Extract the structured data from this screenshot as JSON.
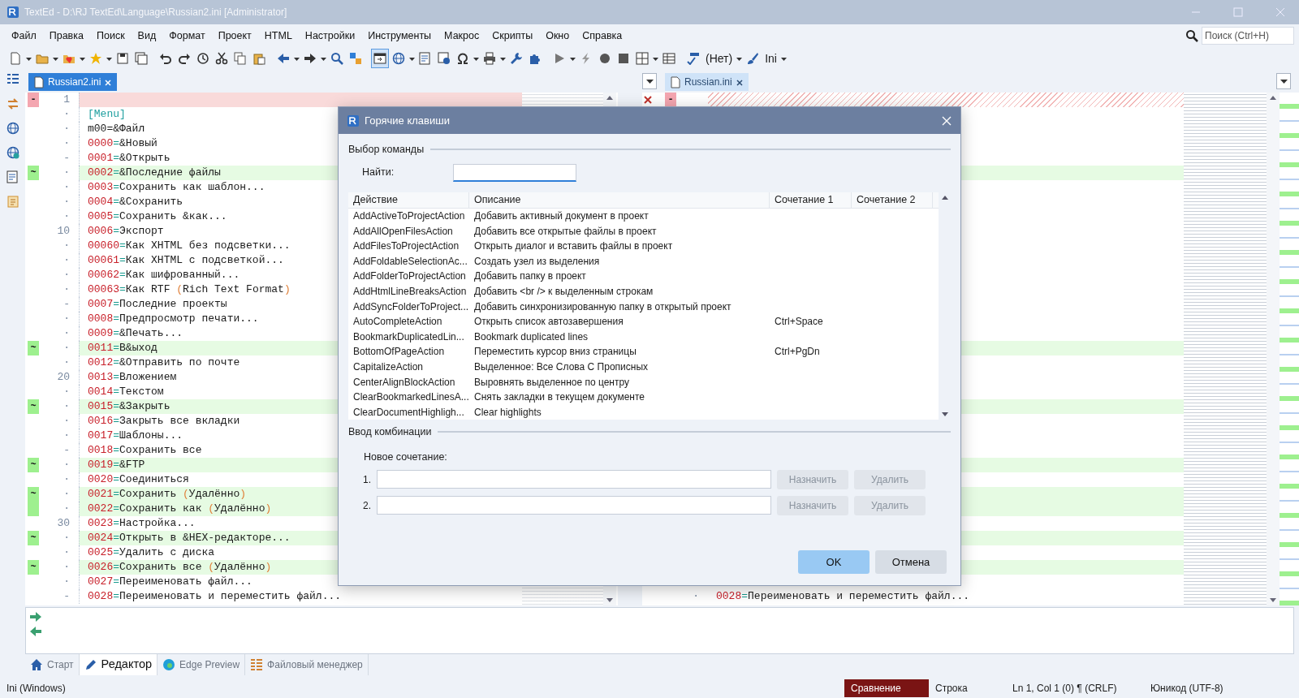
{
  "window": {
    "title": "TextEd - D:\\RJ TextEd\\Language\\Russian2.ini [Administrator]"
  },
  "menu": [
    {
      "label": "Файл"
    },
    {
      "label": "Правка"
    },
    {
      "label": "Поиск"
    },
    {
      "label": "Вид"
    },
    {
      "label": "Формат"
    },
    {
      "label": "Проект"
    },
    {
      "label": "HTML"
    },
    {
      "label": "Настройки"
    },
    {
      "label": "Инструменты"
    },
    {
      "label": "Макрос"
    },
    {
      "label": "Скрипты"
    },
    {
      "label": "Окно"
    },
    {
      "label": "Справка"
    }
  ],
  "search": {
    "placeholder": "Поиск (Ctrl+H)"
  },
  "toolbar": {
    "spell_mode": "(Нет)",
    "syntax": "Ini"
  },
  "tabs_left": [
    {
      "label": "Russian2.ini",
      "selected": true
    }
  ],
  "tabs_right": [
    {
      "label": "Russian.ini",
      "selected": false
    }
  ],
  "editor": {
    "lines": [
      {
        "gutter": "1",
        "deleted": true,
        "changed": false,
        "mark": "-",
        "kind": "empty"
      },
      {
        "gutter": "·",
        "deleted": false,
        "changed": false,
        "kind": "section",
        "text": "[Menu]"
      },
      {
        "gutter": "·",
        "deleted": false,
        "changed": false,
        "kind": "plain",
        "text": "m00=&Файл"
      },
      {
        "gutter": "·",
        "deleted": false,
        "changed": false,
        "kind": "entry",
        "text": "0000=&Новый"
      },
      {
        "gutter": "-",
        "deleted": false,
        "changed": false,
        "kind": "entry",
        "text": "0001=&Открыть"
      },
      {
        "gutter": "·",
        "deleted": false,
        "changed": true,
        "mark": "~",
        "kind": "entry",
        "text": "0002=&Последние файлы"
      },
      {
        "gutter": "·",
        "deleted": false,
        "changed": false,
        "kind": "entry",
        "text": "0003=Сохранить как шаблон..."
      },
      {
        "gutter": "·",
        "deleted": false,
        "changed": false,
        "kind": "entry",
        "text": "0004=&Сохранить"
      },
      {
        "gutter": "·",
        "deleted": false,
        "changed": false,
        "kind": "entry",
        "text": "0005=Сохранить &как..."
      },
      {
        "gutter": "10",
        "deleted": false,
        "changed": false,
        "kind": "entry",
        "text": "0006=Экспорт"
      },
      {
        "gutter": "·",
        "deleted": false,
        "changed": false,
        "kind": "entry",
        "text": "00060=Как XHTML без подсветки..."
      },
      {
        "gutter": "·",
        "deleted": false,
        "changed": false,
        "kind": "entry",
        "text": "00061=Как XHTML с подсветкой..."
      },
      {
        "gutter": "·",
        "deleted": false,
        "changed": false,
        "kind": "entry",
        "text": "00062=Как шифрованный..."
      },
      {
        "gutter": "·",
        "deleted": false,
        "changed": false,
        "kind": "entry",
        "text": "00063=Как RTF (Rich Text Format)"
      },
      {
        "gutter": "-",
        "deleted": false,
        "changed": false,
        "kind": "entry",
        "text": "0007=Последние проекты"
      },
      {
        "gutter": "·",
        "deleted": false,
        "changed": false,
        "kind": "entry",
        "text": "0008=Предпросмотр печати..."
      },
      {
        "gutter": "·",
        "deleted": false,
        "changed": false,
        "kind": "entry",
        "text": "0009=&Печать..."
      },
      {
        "gutter": "·",
        "deleted": false,
        "changed": true,
        "mark": "~",
        "kind": "entry",
        "text": "0011=В&ыход"
      },
      {
        "gutter": "·",
        "deleted": false,
        "changed": false,
        "kind": "entry",
        "text": "0012=&Отправить по почте"
      },
      {
        "gutter": "20",
        "deleted": false,
        "changed": false,
        "kind": "entry",
        "text": "0013=Вложением"
      },
      {
        "gutter": "·",
        "deleted": false,
        "changed": false,
        "kind": "entry",
        "text": "0014=Текстом"
      },
      {
        "gutter": "·",
        "deleted": false,
        "changed": true,
        "mark": "~",
        "kind": "entry",
        "text": "0015=&Закрыть"
      },
      {
        "gutter": "·",
        "deleted": false,
        "changed": false,
        "kind": "entry",
        "text": "0016=Закрыть все вкладки"
      },
      {
        "gutter": "·",
        "deleted": false,
        "changed": false,
        "kind": "entry",
        "text": "0017=Шаблоны..."
      },
      {
        "gutter": "-",
        "deleted": false,
        "changed": false,
        "kind": "entry",
        "text": "0018=Сохранить все"
      },
      {
        "gutter": "·",
        "deleted": false,
        "changed": true,
        "mark": "~",
        "kind": "entry",
        "text": "0019=&FTP"
      },
      {
        "gutter": "·",
        "deleted": false,
        "changed": false,
        "kind": "entry",
        "text": "0020=Соединиться"
      },
      {
        "gutter": "·",
        "deleted": false,
        "changed": true,
        "mark": "~",
        "kind": "entry",
        "text": "0021=Сохранить (Удалённо)"
      },
      {
        "gutter": "·",
        "deleted": false,
        "changed": true,
        "kind": "entry",
        "text": "0022=Сохранить как (Удалённо)"
      },
      {
        "gutter": "30",
        "deleted": false,
        "changed": false,
        "kind": "entry",
        "text": "0023=Настройка..."
      },
      {
        "gutter": "·",
        "deleted": false,
        "changed": true,
        "mark": "~",
        "kind": "entry",
        "text": "0024=Открыть в &HEX-редакторе..."
      },
      {
        "gutter": "·",
        "deleted": false,
        "changed": false,
        "kind": "entry",
        "text": "0025=Удалить с диска"
      },
      {
        "gutter": "·",
        "deleted": false,
        "changed": true,
        "mark": "~",
        "kind": "entry",
        "text": "0026=Сохранить все (Удалённо)"
      },
      {
        "gutter": "·",
        "deleted": false,
        "changed": false,
        "kind": "entry",
        "text": "0027=Переименовать файл..."
      },
      {
        "gutter": "-",
        "deleted": false,
        "changed": false,
        "kind": "entry",
        "text": "0028=Переименовать и переместить файл..."
      }
    ]
  },
  "compare_pane": {
    "mark": "-",
    "gutter": "·",
    "last_line": "0028=Переименовать и переместить файл..."
  },
  "dialog": {
    "title": "Горячие клавиши",
    "select_group": "Выбор команды",
    "find_label": "Найти:",
    "find_focused": true,
    "columns": [
      "Действие",
      "Описание",
      "Сочетание 1",
      "Сочетание 2"
    ],
    "rows": [
      {
        "action": "AddActiveToProjectAction",
        "description": "Добавить активный документ в проект"
      },
      {
        "action": "AddAllOpenFilesAction",
        "description": "Добавить все открытые файлы в проект"
      },
      {
        "action": "AddFilesToProjectAction",
        "description": "Открыть диалог и вставить файлы в проект"
      },
      {
        "action": "AddFoldableSelectionAc...",
        "description": "Создать узел из выделения"
      },
      {
        "action": "AddFolderToProjectAction",
        "description": "Добавить папку в проект"
      },
      {
        "action": "AddHtmlLineBreaksAction",
        "description": "Добавить <br /> к выделенным строкам"
      },
      {
        "action": "AddSyncFolderToProject...",
        "description": "Добавить синхронизированную папку в открытый проект"
      },
      {
        "action": "AutoCompleteAction",
        "description": "Открыть список автозавершения",
        "shortcut_1": "Ctrl+Space"
      },
      {
        "action": "BookmarkDuplicatedLin...",
        "description": "Bookmark duplicated lines"
      },
      {
        "action": "BottomOfPageAction",
        "description": "Переместить курсор вниз страницы",
        "shortcut_1": "Ctrl+PgDn"
      },
      {
        "action": "CapitalizeAction",
        "description": "Выделенное: Все Слова С Прописных"
      },
      {
        "action": "CenterAlignBlockAction",
        "description": "Выровнять выделенное по центру"
      },
      {
        "action": "ClearBookmarkedLinesA...",
        "description": "Снять закладки в текущем документе"
      },
      {
        "action": "ClearDocumentHighligh...",
        "description": "Clear highlights"
      }
    ],
    "input_group": "Ввод комбинации",
    "new_label": "Новое сочетание:",
    "combo_rows": [
      {
        "number": "1.",
        "buttons": [
          {
            "label": "Назначить",
            "disabled": true
          },
          {
            "label": "Удалить",
            "disabled": true
          }
        ]
      },
      {
        "number": "2.",
        "buttons": [
          {
            "label": "Назначить",
            "disabled": true
          },
          {
            "label": "Удалить",
            "disabled": true
          }
        ]
      }
    ],
    "buttons": [
      {
        "label": "OK",
        "kind": "primary"
      },
      {
        "label": "Отмена",
        "kind": "secondary"
      }
    ]
  },
  "bottom_tabs": [
    {
      "label": "Старт",
      "selected": false
    },
    {
      "label": "Редактор",
      "selected": true
    },
    {
      "label": "Edge Preview",
      "selected": false
    },
    {
      "label": "Файловый менеджер",
      "selected": false
    }
  ],
  "status_bar": [
    {
      "text": "Ini (Windows)",
      "highlighted": false
    },
    {
      "text": "Сравнение",
      "highlighted": true
    },
    {
      "text": "Строка",
      "highlighted": false
    },
    {
      "text": "Ln 1, Col 1 (0) ¶ (CRLF)",
      "highlighted": false
    },
    {
      "text": "Юникод (UTF-8)",
      "highlighted": false
    }
  ]
}
